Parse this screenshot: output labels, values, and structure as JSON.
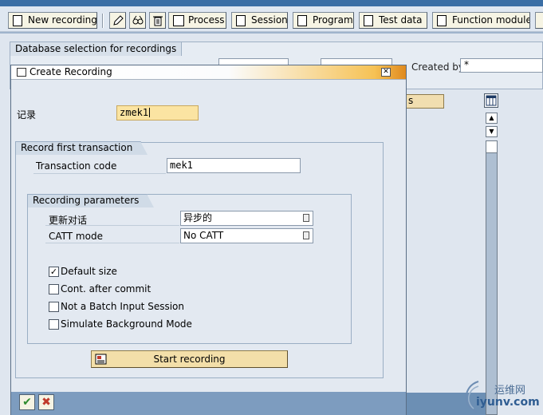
{
  "toolbar": {
    "new_recording": "New recording",
    "process": "Process",
    "session": "Session",
    "program": "Program",
    "test_data": "Test data",
    "function_module": "Function module"
  },
  "background": {
    "group_title": "Database selection for recordings",
    "created_by_label": "Created by",
    "created_by_value": "*",
    "grid_header": "s"
  },
  "dialog": {
    "title": "Create Recording",
    "recording_label": "记录",
    "recording_value": "zmek1",
    "first_tx_group": "Record first transaction",
    "tcode_label": "Transaction code",
    "tcode_value": "mek1",
    "params_group": "Recording parameters",
    "update_mode_label": "更新对话",
    "update_mode_value": "异步的",
    "catt_mode_label": "CATT mode",
    "catt_mode_value": "No CATT",
    "options": [
      {
        "label": "Default size",
        "checked": true
      },
      {
        "label": "Cont. after commit",
        "checked": false
      },
      {
        "label": "Not a Batch Input Session",
        "checked": false
      },
      {
        "label": "Simulate Background Mode",
        "checked": false
      }
    ],
    "start_button": "Start recording",
    "ok_symbol": "✔",
    "cancel_symbol": "✖"
  },
  "watermark": {
    "line1": "运维网",
    "line2": "iyunv.com"
  }
}
